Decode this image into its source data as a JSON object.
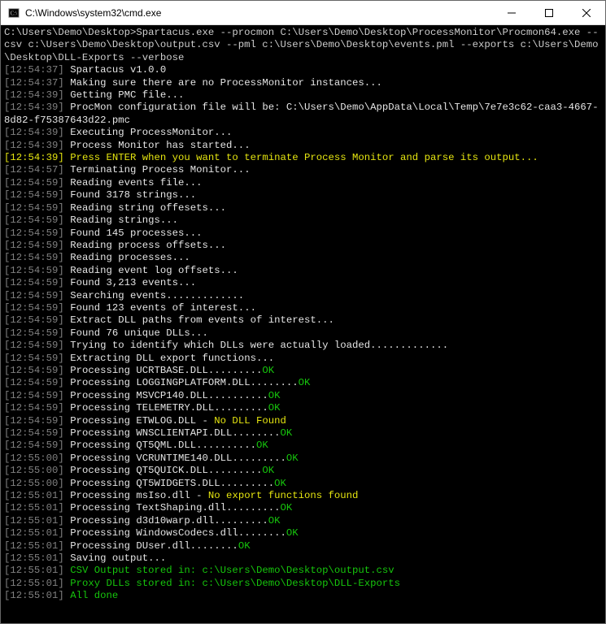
{
  "window": {
    "title": "C:\\Windows\\system32\\cmd.exe"
  },
  "command": {
    "prompt": "C:\\Users\\Demo\\Desktop>",
    "text": "Spartacus.exe --procmon C:\\Users\\Demo\\Desktop\\ProcessMonitor\\Procmon64.exe --csv c:\\Users\\Demo\\Desktop\\output.csv --pml c:\\Users\\Demo\\Desktop\\events.pml --exports c:\\Users\\Demo\\Desktop\\DLL-Exports --verbose"
  },
  "lines": [
    {
      "ts": "[12:54:37]",
      "msg": "Spartacus v1.0.0",
      "c": "w"
    },
    {
      "ts": "[12:54:37]",
      "msg": "Making sure there are no ProcessMonitor instances...",
      "c": "w"
    },
    {
      "ts": "[12:54:39]",
      "msg": "Getting PMC file...",
      "c": "w"
    },
    {
      "ts": "[12:54:39]",
      "msg": "ProcMon configuration file will be: C:\\Users\\Demo\\AppData\\Local\\Temp\\7e7e3c62-caa3-4667-8d82-f75387643d22.pmc",
      "c": "w"
    },
    {
      "ts": "[12:54:39]",
      "msg": "Executing ProcessMonitor...",
      "c": "w"
    },
    {
      "ts": "[12:54:39]",
      "msg": "Process Monitor has started...",
      "c": "w"
    },
    {
      "ts": "[12:54:39]",
      "msg": "Press ENTER when you want to terminate Process Monitor and parse its output...",
      "c": "y",
      "tsc": "y"
    },
    {
      "ts": "[12:54:57]",
      "msg": "Terminating Process Monitor...",
      "c": "w"
    },
    {
      "ts": "[12:54:59]",
      "msg": "Reading events file...",
      "c": "w"
    },
    {
      "ts": "[12:54:59]",
      "msg": "Found 3178 strings...",
      "c": "w"
    },
    {
      "ts": "[12:54:59]",
      "msg": "Reading string offesets...",
      "c": "w"
    },
    {
      "ts": "[12:54:59]",
      "msg": "Reading strings...",
      "c": "w"
    },
    {
      "ts": "[12:54:59]",
      "msg": "Found 145 processes...",
      "c": "w"
    },
    {
      "ts": "[12:54:59]",
      "msg": "Reading process offsets...",
      "c": "w"
    },
    {
      "ts": "[12:54:59]",
      "msg": "Reading processes...",
      "c": "w"
    },
    {
      "ts": "[12:54:59]",
      "msg": "Reading event log offsets...",
      "c": "w"
    },
    {
      "ts": "[12:54:59]",
      "msg": "Found 3,213 events...",
      "c": "w"
    },
    {
      "ts": "[12:54:59]",
      "msg": "Searching events.............",
      "c": "w"
    },
    {
      "ts": "[12:54:59]",
      "msg": "Found 123 events of interest...",
      "c": "w"
    },
    {
      "ts": "[12:54:59]",
      "msg": "Extract DLL paths from events of interest...",
      "c": "w"
    },
    {
      "ts": "[12:54:59]",
      "msg": "Found 76 unique DLLs...",
      "c": "w"
    },
    {
      "ts": "[12:54:59]",
      "msg": "Trying to identify which DLLs were actually loaded.............",
      "c": "w"
    },
    {
      "ts": "[12:54:59]",
      "msg": "Extracting DLL export functions...",
      "c": "w"
    },
    {
      "ts": "[12:54:59]",
      "lead": "Processing UCRTBASE.DLL",
      "dots": ".........",
      "status": "OK",
      "sc": "g"
    },
    {
      "ts": "[12:54:59]",
      "lead": "Processing LOGGINGPLATFORM.DLL",
      "dots": "........",
      "status": "OK",
      "sc": "g"
    },
    {
      "ts": "[12:54:59]",
      "lead": "Processing MSVCP140.DLL",
      "dots": "..........",
      "status": "OK",
      "sc": "g"
    },
    {
      "ts": "[12:54:59]",
      "lead": "Processing TELEMETRY.DLL",
      "dots": ".........",
      "status": "OK",
      "sc": "g"
    },
    {
      "ts": "[12:54:59]",
      "lead": "Processing ETWLOG.DLL - ",
      "dots": "",
      "status": "No DLL Found",
      "sc": "y"
    },
    {
      "ts": "[12:54:59]",
      "lead": "Processing WNSCLIENTAPI.DLL",
      "dots": "........",
      "status": "OK",
      "sc": "g"
    },
    {
      "ts": "[12:54:59]",
      "lead": "Processing QT5QML.DLL",
      "dots": "..........",
      "status": "OK",
      "sc": "g"
    },
    {
      "ts": "[12:55:00]",
      "lead": "Processing VCRUNTIME140.DLL",
      "dots": ".........",
      "status": "OK",
      "sc": "g"
    },
    {
      "ts": "[12:55:00]",
      "lead": "Processing QT5QUICK.DLL",
      "dots": ".........",
      "status": "OK",
      "sc": "g"
    },
    {
      "ts": "[12:55:00]",
      "lead": "Processing QT5WIDGETS.DLL",
      "dots": ".........",
      "status": "OK",
      "sc": "g"
    },
    {
      "ts": "[12:55:01]",
      "lead": "Processing msIso.dll - ",
      "dots": "",
      "status": "No export functions found",
      "sc": "y"
    },
    {
      "ts": "[12:55:01]",
      "lead": "Processing TextShaping.dll",
      "dots": ".........",
      "status": "OK",
      "sc": "g"
    },
    {
      "ts": "[12:55:01]",
      "lead": "Processing d3d10warp.dll",
      "dots": ".........",
      "status": "OK",
      "sc": "g"
    },
    {
      "ts": "[12:55:01]",
      "lead": "Processing WindowsCodecs.dll",
      "dots": "........",
      "status": "OK",
      "sc": "g"
    },
    {
      "ts": "[12:55:01]",
      "lead": "Processing DUser.dll",
      "dots": "........",
      "status": "OK",
      "sc": "g"
    },
    {
      "ts": "[12:55:01]",
      "msg": "Saving output...",
      "c": "w"
    },
    {
      "ts": "[12:55:01]",
      "msg": "CSV Output stored in: c:\\Users\\Demo\\Desktop\\output.csv",
      "c": "g"
    },
    {
      "ts": "[12:55:01]",
      "msg": "Proxy DLLs stored in: c:\\Users\\Demo\\Desktop\\DLL-Exports",
      "c": "g"
    },
    {
      "ts": "[12:55:01]",
      "msg": "All done",
      "c": "g"
    }
  ]
}
